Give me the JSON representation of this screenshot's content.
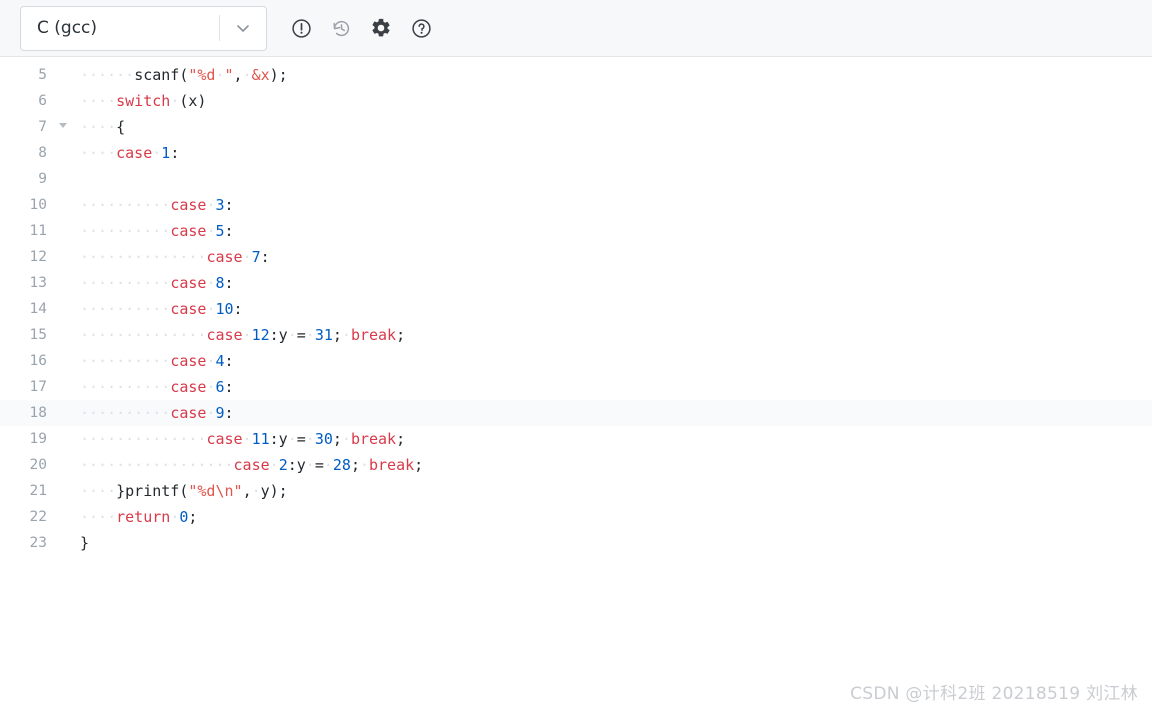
{
  "toolbar": {
    "language_label": "C (gcc)",
    "dropdown_icon": "chevron-down-icon",
    "icons": [
      {
        "name": "error-icon",
        "glyph": "!"
      },
      {
        "name": "history-icon",
        "glyph": "history"
      },
      {
        "name": "settings-icon",
        "glyph": "gear"
      },
      {
        "name": "help-icon",
        "glyph": "?"
      }
    ]
  },
  "editor": {
    "language": "c",
    "active_line": 18,
    "fold_lines": [
      7
    ],
    "lines": [
      {
        "number": "5",
        "indent": 6,
        "tokens": [
          {
            "t": "scanf(",
            "c": "pln"
          },
          {
            "t": "\"%d",
            "c": "str"
          },
          {
            "t": "·",
            "c": "ws"
          },
          {
            "t": "\"",
            "c": "str"
          },
          {
            "t": ",",
            "c": "pln"
          },
          {
            "t": "·",
            "c": "ws"
          },
          {
            "t": "&x",
            "c": "var"
          },
          {
            "t": ");",
            "c": "pln"
          }
        ]
      },
      {
        "number": "6",
        "indent": 4,
        "tokens": [
          {
            "t": "switch",
            "c": "kw"
          },
          {
            "t": "·",
            "c": "ws"
          },
          {
            "t": "(x)",
            "c": "pln"
          }
        ]
      },
      {
        "number": "7",
        "indent": 4,
        "tokens": [
          {
            "t": "{",
            "c": "pln"
          }
        ]
      },
      {
        "number": "8",
        "indent": 4,
        "tokens": [
          {
            "t": "case",
            "c": "kw"
          },
          {
            "t": "·",
            "c": "ws"
          },
          {
            "t": "1",
            "c": "num"
          },
          {
            "t": ":",
            "c": "pln"
          }
        ]
      },
      {
        "number": "9",
        "indent": 0,
        "tokens": []
      },
      {
        "number": "10",
        "indent": 10,
        "tokens": [
          {
            "t": "case",
            "c": "kw"
          },
          {
            "t": "·",
            "c": "ws"
          },
          {
            "t": "3",
            "c": "num"
          },
          {
            "t": ":",
            "c": "pln"
          }
        ]
      },
      {
        "number": "11",
        "indent": 10,
        "tokens": [
          {
            "t": "case",
            "c": "kw"
          },
          {
            "t": "·",
            "c": "ws"
          },
          {
            "t": "5",
            "c": "num"
          },
          {
            "t": ":",
            "c": "pln"
          }
        ]
      },
      {
        "number": "12",
        "indent": 14,
        "tokens": [
          {
            "t": "case",
            "c": "kw"
          },
          {
            "t": "·",
            "c": "ws"
          },
          {
            "t": "7",
            "c": "num"
          },
          {
            "t": ":",
            "c": "pln"
          }
        ]
      },
      {
        "number": "13",
        "indent": 10,
        "tokens": [
          {
            "t": "case",
            "c": "kw"
          },
          {
            "t": "·",
            "c": "ws"
          },
          {
            "t": "8",
            "c": "num"
          },
          {
            "t": ":",
            "c": "pln"
          }
        ]
      },
      {
        "number": "14",
        "indent": 10,
        "tokens": [
          {
            "t": "case",
            "c": "kw"
          },
          {
            "t": "·",
            "c": "ws"
          },
          {
            "t": "10",
            "c": "num"
          },
          {
            "t": ":",
            "c": "pln"
          }
        ]
      },
      {
        "number": "15",
        "indent": 14,
        "tokens": [
          {
            "t": "case",
            "c": "kw"
          },
          {
            "t": "·",
            "c": "ws"
          },
          {
            "t": "12",
            "c": "num"
          },
          {
            "t": ":y",
            "c": "pln"
          },
          {
            "t": "·",
            "c": "ws"
          },
          {
            "t": "=",
            "c": "pln"
          },
          {
            "t": "·",
            "c": "ws"
          },
          {
            "t": "31",
            "c": "num"
          },
          {
            "t": ";",
            "c": "pln"
          },
          {
            "t": "·",
            "c": "ws"
          },
          {
            "t": "break",
            "c": "kw"
          },
          {
            "t": ";",
            "c": "pln"
          }
        ]
      },
      {
        "number": "16",
        "indent": 10,
        "tokens": [
          {
            "t": "case",
            "c": "kw"
          },
          {
            "t": "·",
            "c": "ws"
          },
          {
            "t": "4",
            "c": "num"
          },
          {
            "t": ":",
            "c": "pln"
          }
        ]
      },
      {
        "number": "17",
        "indent": 10,
        "tokens": [
          {
            "t": "case",
            "c": "kw"
          },
          {
            "t": "·",
            "c": "ws"
          },
          {
            "t": "6",
            "c": "num"
          },
          {
            "t": ":",
            "c": "pln"
          }
        ]
      },
      {
        "number": "18",
        "indent": 10,
        "tokens": [
          {
            "t": "case",
            "c": "kw"
          },
          {
            "t": "·",
            "c": "ws"
          },
          {
            "t": "9",
            "c": "num"
          },
          {
            "t": ":",
            "c": "pln"
          }
        ]
      },
      {
        "number": "19",
        "indent": 14,
        "tokens": [
          {
            "t": "case",
            "c": "kw"
          },
          {
            "t": "·",
            "c": "ws"
          },
          {
            "t": "11",
            "c": "num"
          },
          {
            "t": ":y",
            "c": "pln"
          },
          {
            "t": "·",
            "c": "ws"
          },
          {
            "t": "=",
            "c": "pln"
          },
          {
            "t": "·",
            "c": "ws"
          },
          {
            "t": "30",
            "c": "num"
          },
          {
            "t": ";",
            "c": "pln"
          },
          {
            "t": "·",
            "c": "ws"
          },
          {
            "t": "break",
            "c": "kw"
          },
          {
            "t": ";",
            "c": "pln"
          }
        ]
      },
      {
        "number": "20",
        "indent": 17,
        "tokens": [
          {
            "t": "case",
            "c": "kw"
          },
          {
            "t": "·",
            "c": "ws"
          },
          {
            "t": "2",
            "c": "num"
          },
          {
            "t": ":y",
            "c": "pln"
          },
          {
            "t": "·",
            "c": "ws"
          },
          {
            "t": "=",
            "c": "pln"
          },
          {
            "t": "·",
            "c": "ws"
          },
          {
            "t": "28",
            "c": "num"
          },
          {
            "t": ";",
            "c": "pln"
          },
          {
            "t": "·",
            "c": "ws"
          },
          {
            "t": "break",
            "c": "kw"
          },
          {
            "t": ";",
            "c": "pln"
          }
        ]
      },
      {
        "number": "21",
        "indent": 4,
        "tokens": [
          {
            "t": "}printf(",
            "c": "pln"
          },
          {
            "t": "\"%d\\n\"",
            "c": "str"
          },
          {
            "t": ",",
            "c": "pln"
          },
          {
            "t": "·",
            "c": "ws"
          },
          {
            "t": "y);",
            "c": "pln"
          }
        ]
      },
      {
        "number": "22",
        "indent": 4,
        "tokens": [
          {
            "t": "return",
            "c": "kw"
          },
          {
            "t": "·",
            "c": "ws"
          },
          {
            "t": "0",
            "c": "num"
          },
          {
            "t": ";",
            "c": "pln"
          }
        ]
      },
      {
        "number": "23",
        "indent": 0,
        "tokens": [
          {
            "t": "}",
            "c": "pln"
          }
        ]
      }
    ]
  },
  "watermark": {
    "text": "CSDN @计科2班 20218519 刘江林"
  }
}
